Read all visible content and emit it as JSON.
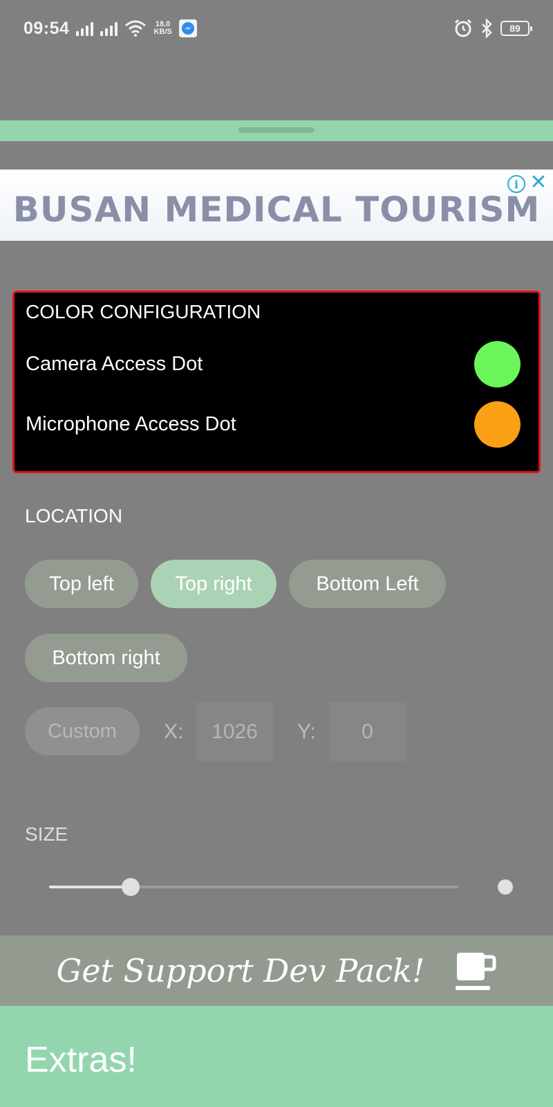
{
  "status_bar": {
    "time": "09:54",
    "net_speed_value": "18.0",
    "net_speed_unit": "KB/S",
    "battery": "89"
  },
  "ad": {
    "text": "BUSAN MEDICAL TOURISM",
    "info_symbol": "i",
    "close_symbol": "✕"
  },
  "color_config": {
    "title": "COLOR CONFIGURATION",
    "rows": [
      {
        "label": "Camera Access Dot",
        "color": "#6af55a"
      },
      {
        "label": "Microphone Access Dot",
        "color": "#fb9f14"
      }
    ]
  },
  "location": {
    "title": "LOCATION",
    "options": {
      "top_left": "Top left",
      "top_right": "Top right",
      "bottom_left": "Bottom Left",
      "bottom_right": "Bottom right",
      "custom": "Custom"
    },
    "selected": "Top right",
    "x_label": "X:",
    "x_value": "1026",
    "y_label": "Y:",
    "y_value": "0"
  },
  "size": {
    "title": "SIZE",
    "slider_fraction": 0.2
  },
  "support": {
    "label": "Get Support Dev Pack!"
  },
  "extras": {
    "label": "Extras!"
  },
  "colors": {
    "accent_green": "#93d6ae",
    "card_border": "#e0131a"
  }
}
